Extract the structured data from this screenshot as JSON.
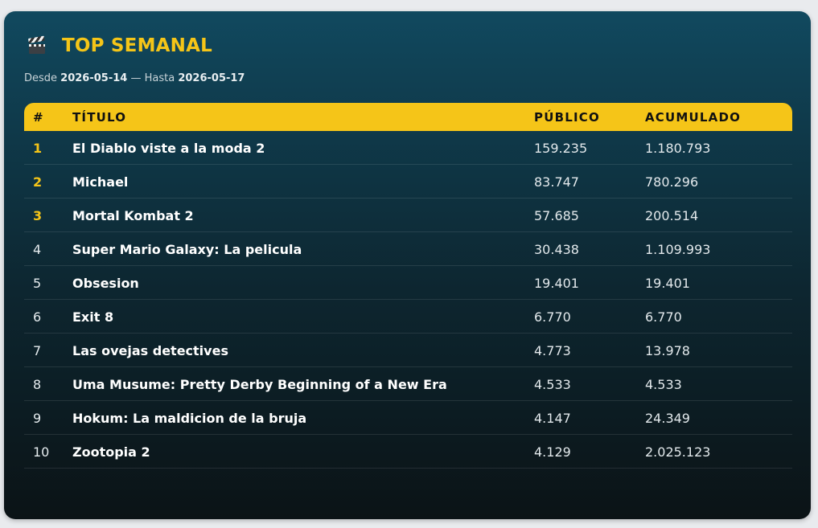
{
  "header": {
    "icon": "clapperboard-icon",
    "title": "TOP SEMANAL"
  },
  "date_range": {
    "from_label": "Desde",
    "from": "2026-05-14",
    "separator": "—",
    "to_label": "Hasta",
    "to": "2026-05-17"
  },
  "table": {
    "columns": [
      "#",
      "TÍTULO",
      "PÚBLICO",
      "ACUMULADO"
    ],
    "rows": [
      {
        "rank": "1",
        "title": "El Diablo viste a la moda 2",
        "publico": "159.235",
        "acumulado": "1.180.793"
      },
      {
        "rank": "2",
        "title": "Michael",
        "publico": "83.747",
        "acumulado": "780.296"
      },
      {
        "rank": "3",
        "title": "Mortal Kombat 2",
        "publico": "57.685",
        "acumulado": "200.514"
      },
      {
        "rank": "4",
        "title": "Super Mario Galaxy: La pelicula",
        "publico": "30.438",
        "acumulado": "1.109.993"
      },
      {
        "rank": "5",
        "title": "Obsesion",
        "publico": "19.401",
        "acumulado": "19.401"
      },
      {
        "rank": "6",
        "title": "Exit 8",
        "publico": "6.770",
        "acumulado": "6.770"
      },
      {
        "rank": "7",
        "title": "Las ovejas detectives",
        "publico": "4.773",
        "acumulado": "13.978"
      },
      {
        "rank": "8",
        "title": "Uma Musume: Pretty Derby Beginning of a New Era",
        "publico": "4.533",
        "acumulado": "4.533"
      },
      {
        "rank": "9",
        "title": "Hokum: La maldicion de la bruja",
        "publico": "4.147",
        "acumulado": "24.349"
      },
      {
        "rank": "10",
        "title": "Zootopia 2",
        "publico": "4.129",
        "acumulado": "2.025.123"
      }
    ]
  },
  "colors": {
    "accent": "#f5c518",
    "card_top": "#11495f",
    "card_bottom": "#0b1316"
  }
}
